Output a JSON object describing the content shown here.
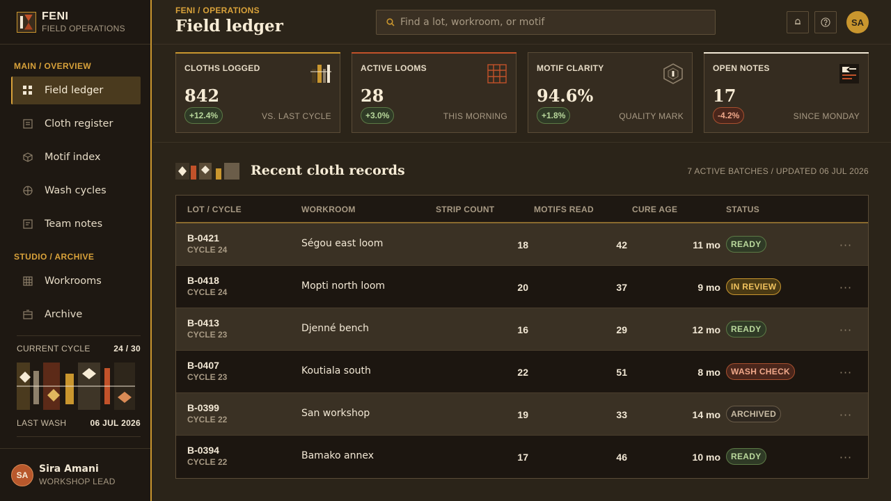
{
  "brand": {
    "name": "FENI",
    "subtitle": "FIELD OPERATIONS"
  },
  "nav": {
    "section_main": "MAIN / OVERVIEW",
    "section_archive": "STUDIO / ARCHIVE",
    "items": [
      {
        "label": "Field ledger",
        "icon": "grid-icon",
        "active": true
      },
      {
        "label": "Cloth register",
        "icon": "document-icon"
      },
      {
        "label": "Motif index",
        "icon": "cube-icon"
      },
      {
        "label": "Wash cycles",
        "icon": "cycle-icon"
      },
      {
        "label": "Team notes",
        "icon": "notes-icon"
      }
    ],
    "archive_items": [
      {
        "label": "Workrooms",
        "icon": "table-icon"
      },
      {
        "label": "Archive",
        "icon": "box-icon"
      }
    ]
  },
  "cycle": {
    "label": "CURRENT CYCLE",
    "value": "24 / 30",
    "last_wash_label": "LAST WASH",
    "last_wash_value": "06 JUL 2026"
  },
  "user": {
    "initials": "SA",
    "name": "Sira Amani",
    "role": "WORKSHOP LEAD"
  },
  "header": {
    "breadcrumb": "FENI / OPERATIONS",
    "title": "Field ledger",
    "search_placeholder": "Find a lot, workroom, or motif",
    "avatar_initials": "SA"
  },
  "kpis": [
    {
      "label": "CLOTHS LOGGED",
      "value": "842",
      "delta": "+12.4%",
      "trend": "up",
      "note": "VS. LAST CYCLE",
      "accent": "#c9962e"
    },
    {
      "label": "ACTIVE LOOMS",
      "value": "28",
      "delta": "+3.0%",
      "trend": "up",
      "note": "THIS MORNING",
      "accent": "#c2522a"
    },
    {
      "label": "MOTIF CLARITY",
      "value": "94.6%",
      "delta": "+1.8%",
      "trend": "up",
      "note": "QUALITY MARK",
      "accent": "#8e806b"
    },
    {
      "label": "OPEN NOTES",
      "value": "17",
      "delta": "-4.2%",
      "trend": "down",
      "note": "SINCE MONDAY",
      "accent": "#f2e8d5"
    }
  ],
  "section": {
    "title": "Recent cloth records",
    "meta": "7 ACTIVE BATCHES / UPDATED 06 JUL 2026"
  },
  "table": {
    "columns": [
      "LOT / CYCLE",
      "WORKROOM",
      "STRIP COUNT",
      "MOTIFS READ",
      "CURE AGE",
      "STATUS"
    ],
    "rows": [
      {
        "lot": "B-0421",
        "cycle": "CYCLE 24",
        "workroom": "Ségou east loom",
        "strips": "18",
        "motifs": "42",
        "cure": "11 mo",
        "status": "READY",
        "status_kind": "ready"
      },
      {
        "lot": "B-0418",
        "cycle": "CYCLE 24",
        "workroom": "Mopti north loom",
        "strips": "20",
        "motifs": "37",
        "cure": "9 mo",
        "status": "IN REVIEW",
        "status_kind": "review"
      },
      {
        "lot": "B-0413",
        "cycle": "CYCLE 23",
        "workroom": "Djenné bench",
        "strips": "16",
        "motifs": "29",
        "cure": "12 mo",
        "status": "READY",
        "status_kind": "ready"
      },
      {
        "lot": "B-0407",
        "cycle": "CYCLE 23",
        "workroom": "Koutiala south",
        "strips": "22",
        "motifs": "51",
        "cure": "8 mo",
        "status": "WASH CHECK",
        "status_kind": "wash"
      },
      {
        "lot": "B-0399",
        "cycle": "CYCLE 22",
        "workroom": "San workshop",
        "strips": "19",
        "motifs": "33",
        "cure": "14 mo",
        "status": "ARCHIVED",
        "status_kind": "arch"
      },
      {
        "lot": "B-0394",
        "cycle": "CYCLE 22",
        "workroom": "Bamako annex",
        "strips": "17",
        "motifs": "46",
        "cure": "10 mo",
        "status": "READY",
        "status_kind": "ready"
      }
    ]
  }
}
